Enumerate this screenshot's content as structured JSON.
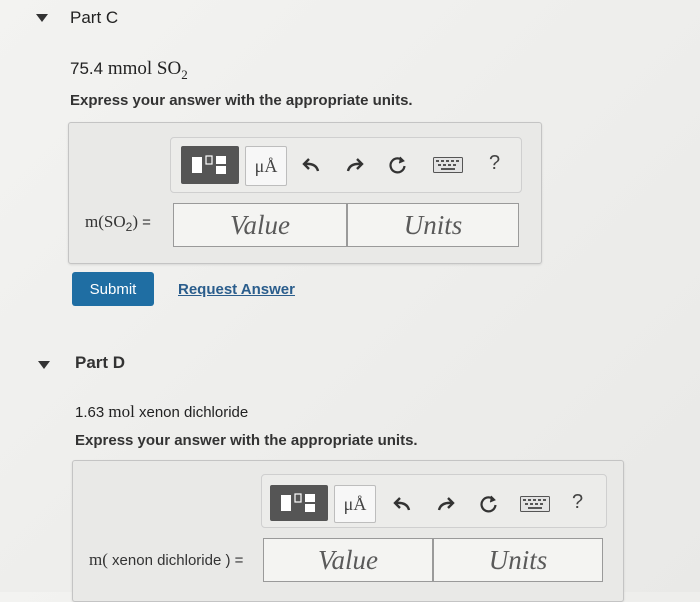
{
  "partC": {
    "title": "Part C",
    "problem_value": "75.4",
    "problem_unit": "mmol",
    "formula_base": "SO",
    "formula_sub": "2",
    "instruction": "Express your answer with the appropriate units.",
    "var_prefix": "m(SO",
    "var_sub": "2",
    "var_suffix": ") =",
    "value_placeholder": "Value",
    "units_placeholder": "Units",
    "submit_label": "Submit",
    "request_label": "Request Answer"
  },
  "partD": {
    "title": "Part D",
    "problem_value": "1.63",
    "problem_unit": "mol",
    "problem_name": "xenon dichloride",
    "instruction": "Express your answer with the appropriate units.",
    "var_prefix": "m(",
    "var_name": " xenon dichloride ",
    "var_suffix": ") =",
    "value_placeholder": "Value",
    "units_placeholder": "Units"
  },
  "toolbar": {
    "unit_symbol": "μÅ",
    "help_label": "?"
  },
  "colors": {
    "submit": "#1f6ea3",
    "link": "#2a5d8c"
  }
}
